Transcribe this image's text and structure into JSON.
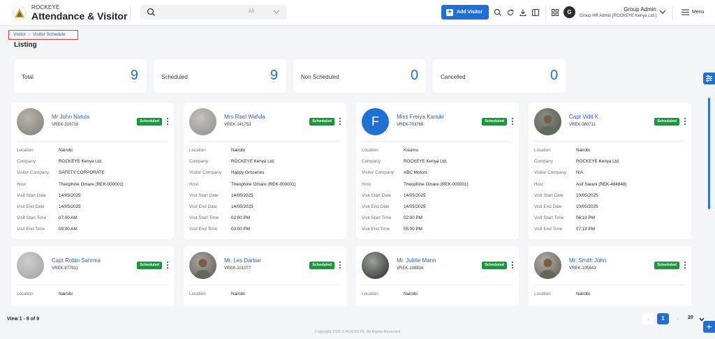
{
  "header": {
    "brand_top": "ROCKEYE",
    "brand_main": "Attendance & Visitor",
    "search_scope": "All",
    "add_visitor_label": "Add Visitor",
    "user_name": "Group Admin",
    "user_role": "Group HR Admin [ROCKEYE Kenya Ltd.]",
    "user_initial": "G",
    "menu_label": "Menu"
  },
  "breadcrumb": {
    "root": "Visitor",
    "separator": ">",
    "current": "Visitor Schedule"
  },
  "page_title": "Listing",
  "stats": [
    {
      "label": "Total",
      "value": "9"
    },
    {
      "label": "Scheduled",
      "value": "9"
    },
    {
      "label": "Non Scheduled",
      "value": "0"
    },
    {
      "label": "Cancelled",
      "value": "0"
    }
  ],
  "field_labels": {
    "location": "Location",
    "company": "Company",
    "visitor_company": "Visitor Company",
    "host": "Host",
    "visit_start_date": "Visit Start Date",
    "visit_end_date": "Visit End Date",
    "visit_start_time": "Visit Start Time",
    "visit_end_time": "Visit End Time"
  },
  "visitors": [
    {
      "name": "Mr John Natula",
      "id": "VREK-319718",
      "status": "Scheduled",
      "location": "Nairobi",
      "company": "ROCKEYE Kenya Ltd.",
      "visitor_company": "SAFETY CORPORATE",
      "host": "Theophine Omare (REK-000001)",
      "visit_start_date": "14/05/2025",
      "visit_end_date": "14/05/2025",
      "visit_start_time": "07:00 AM",
      "visit_end_time": "09:00 AM"
    },
    {
      "name": "Mrs Rael Wafula",
      "id": "VREK-141753",
      "status": "Scheduled",
      "location": "Nairobi",
      "company": "ROCKEYE Kenya Ltd.",
      "visitor_company": "Happy Groceries",
      "host": "Theophine Omare (REK-000001)",
      "visit_start_date": "14/05/2025",
      "visit_end_date": "14/05/2025",
      "visit_start_time": "02:00 PM",
      "visit_end_time": "03:00 PM"
    },
    {
      "name": "Miss Freiya Kariuki",
      "id": "VREK-703765",
      "status": "Scheduled",
      "avatar_letter": "F",
      "location": "Kisumu",
      "company": "ROCKEYE Kenya Ltd.",
      "visitor_company": "ABC Motors",
      "host": "Theophine Omare (REK-000001)",
      "visit_start_date": "14/05/2025",
      "visit_end_date": "14/05/2025",
      "visit_start_time": "02:00 PM",
      "visit_end_time": "05:00 PM"
    },
    {
      "name": "Capt Vidit K",
      "id": "VREK-580711",
      "status": "Scheduled",
      "location": "Nairobi",
      "company": "ROCKEYE Kenya Ltd.",
      "visitor_company": "N/A",
      "host": "Asif Sarani (REK-484848)",
      "visit_start_date": "10/05/2025",
      "visit_end_date": "10/05/2025",
      "visit_start_time": "06:19 PM",
      "visit_end_time": "07:19 PM"
    },
    {
      "name": "Capt Robin Sahrma",
      "id": "VREK-877911",
      "status": "Scheduled",
      "location": "Nairobi"
    },
    {
      "name": "Mr. Les Darbar",
      "id": "VREK-101077",
      "status": "Scheduled",
      "location": "Nairobi"
    },
    {
      "name": "Mr. Julirle Mann",
      "id": "VREK-108834",
      "status": "Scheduled",
      "location": "Nairobi"
    },
    {
      "name": "Mr. Smith John",
      "id": "VREK-105843",
      "status": "Scheduled",
      "location": "Nairobi"
    }
  ],
  "footer": {
    "view_text": "View 1 - 9 of 9",
    "current_page": "1",
    "page_size": "20",
    "copyright": "Copyright 2025 © ROCKEYE. All Rights Reserved"
  },
  "icons": {
    "search": "search-icon",
    "chevron": "chevron-down-icon",
    "plus": "plus-icon",
    "header_actions": [
      "search-icon",
      "refresh-icon",
      "download-icon",
      "layout-icon",
      "apps-grid-icon"
    ],
    "more": "more-vertical-icon",
    "filter": "filter-sliders-icon",
    "menu": "hamburger-icon"
  },
  "colors": {
    "accent": "#1f6fd6",
    "scheduled": "#159a3b",
    "breadcrumb_border": "#e53935"
  }
}
